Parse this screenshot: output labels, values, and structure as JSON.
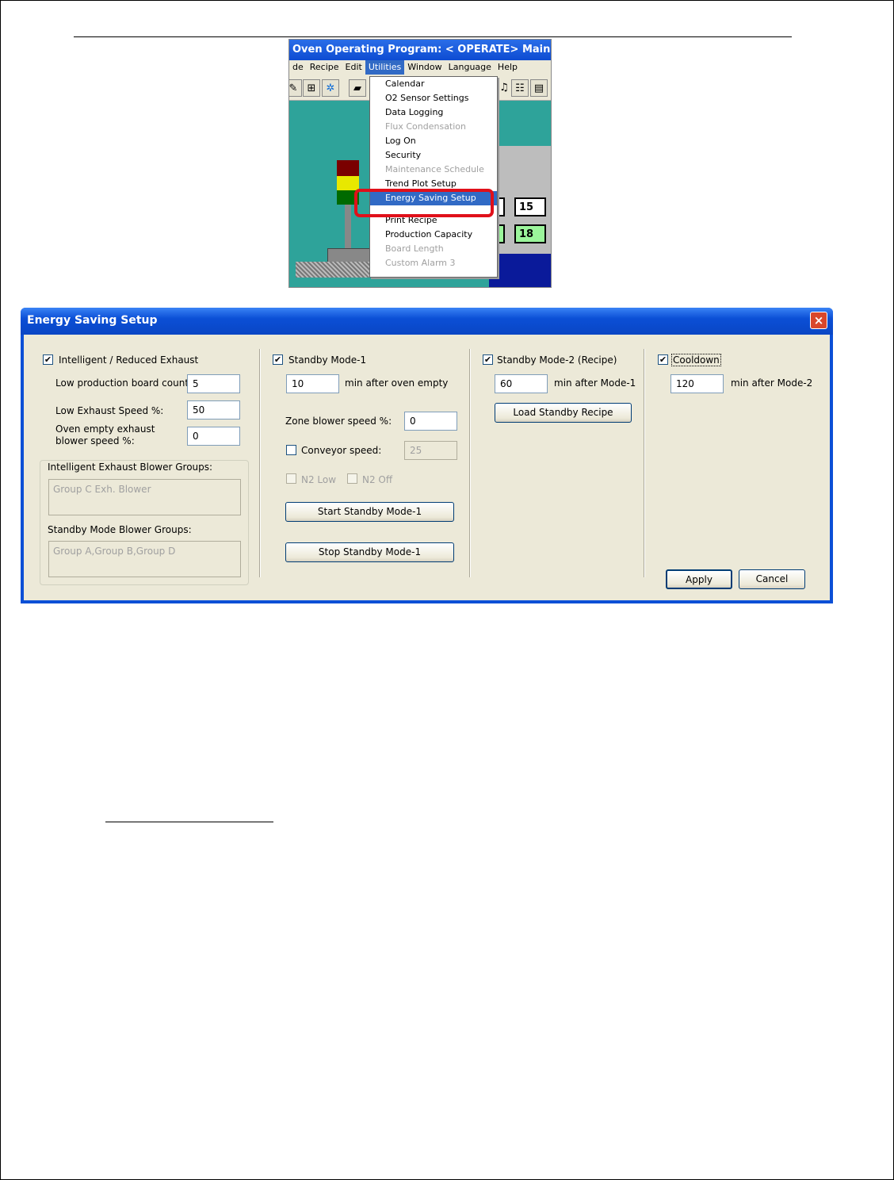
{
  "menu_screenshot": {
    "window_title": "Oven Operating Program: < OPERATE> Main Overv",
    "menu_bar": [
      "de",
      "Recipe",
      "Edit",
      "Utilities",
      "Window",
      "Language",
      "Help"
    ],
    "active_menu": "Utilities",
    "utilities_menu": [
      {
        "label": "Calendar",
        "enabled": true
      },
      {
        "label": "O2 Sensor Settings",
        "enabled": true
      },
      {
        "label": "Data Logging",
        "enabled": true
      },
      {
        "label": "Flux Condensation",
        "enabled": false
      },
      {
        "label": "Log On",
        "enabled": true
      },
      {
        "label": "Security",
        "enabled": true
      },
      {
        "label": "Maintenance Schedule",
        "enabled": false
      },
      {
        "label": "Trend Plot Setup",
        "enabled": true
      },
      {
        "label": "Energy Saving Setup",
        "enabled": true,
        "highlighted": true
      },
      {
        "label": "Print Recipe",
        "enabled": true
      },
      {
        "label": "Production Capacity",
        "enabled": true
      },
      {
        "label": "Board Length",
        "enabled": false
      },
      {
        "label": "Custom Alarm 3",
        "enabled": false
      }
    ],
    "readouts": [
      "15",
      "18"
    ],
    "colors": {
      "highlight_callout": "#e0101a",
      "menu_highlight": "#316ac5",
      "overview_background": "#2ea39a"
    }
  },
  "dialog": {
    "title": "Energy Saving Setup",
    "close_glyph": "×",
    "check_glyph": "✔",
    "exhaust": {
      "label": "Intelligent / Reduced Exhaust",
      "checked": true,
      "low_count_label": "Low production board count:",
      "low_count_value": "5",
      "low_speed_label": "Low Exhaust Speed %:",
      "low_speed_value": "50",
      "empty_speed_label_line1": "Oven empty exhaust",
      "empty_speed_label_line2": "blower speed %:",
      "empty_speed_value": "0",
      "exhaust_groups_label": "Intelligent Exhaust Blower Groups:",
      "exhaust_groups_value": "Group C Exh. Blower",
      "standby_groups_label": "Standby Mode Blower Groups:",
      "standby_groups_value": "Group A,Group B,Group D"
    },
    "standby1": {
      "label": "Standby Mode-1",
      "checked": true,
      "minutes_value": "10",
      "minutes_label": "min after oven empty",
      "zone_speed_label": "Zone blower speed %:",
      "zone_speed_value": "0",
      "conveyor_label": "Conveyor speed:",
      "conveyor_checked": false,
      "conveyor_value": "25",
      "n2_low_label": "N2 Low",
      "n2_off_label": "N2 Off",
      "start_button": "Start Standby Mode-1",
      "stop_button": "Stop Standby Mode-1"
    },
    "standby2": {
      "label": "Standby Mode-2 (Recipe)",
      "checked": true,
      "minutes_value": "60",
      "minutes_label": "min after Mode-1",
      "load_button": "Load Standby Recipe"
    },
    "cooldown": {
      "label": "Cooldown",
      "checked": true,
      "minutes_value": "120",
      "minutes_label": "min after Mode-2"
    },
    "apply_button": "Apply",
    "cancel_button": "Cancel"
  }
}
